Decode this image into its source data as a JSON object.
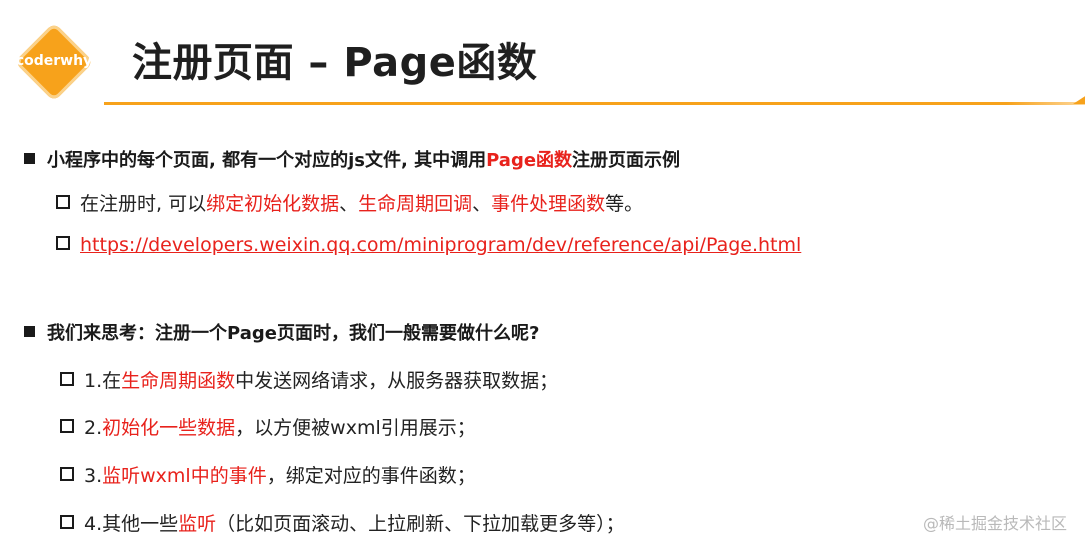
{
  "logo": {
    "text": "coderwhy"
  },
  "title": "注册页面 – Page函数",
  "section1": {
    "heading_a": "小程序中的每个页面, 都有一个对应的js文件, 其中调用",
    "heading_red": "Page函数",
    "heading_b": "注册页面示例",
    "item1": {
      "a": "在注册时, 可以",
      "red1": "绑定初始化数据",
      "sep1": "、",
      "red2": "生命周期回调",
      "sep2": "、",
      "red3": "事件处理函数",
      "b": "等。"
    },
    "item2_link": "https://developers.weixin.qq.com/miniprogram/dev/reference/api/Page.html"
  },
  "section2": {
    "heading": "我们来思考：注册一个Page页面时，我们一般需要做什么呢?",
    "items": [
      {
        "prefix": "1.在",
        "red": "生命周期函数",
        "suffix": "中发送网络请求，从服务器获取数据；"
      },
      {
        "prefix": "2.",
        "red": "初始化一些数据",
        "suffix": "，以方便被wxml引用展示；"
      },
      {
        "prefix": "3.",
        "red": "监听wxml中的事件",
        "suffix": "，绑定对应的事件函数；"
      },
      {
        "prefix": "4.其他一些",
        "red": "监听",
        "suffix": "（比如页面滚动、上拉刷新、下拉加载更多等）；"
      }
    ]
  },
  "watermark": "@稀土掘金技术社区",
  "colors": {
    "accent": "#f7a21b",
    "highlight": "#e8221c"
  }
}
